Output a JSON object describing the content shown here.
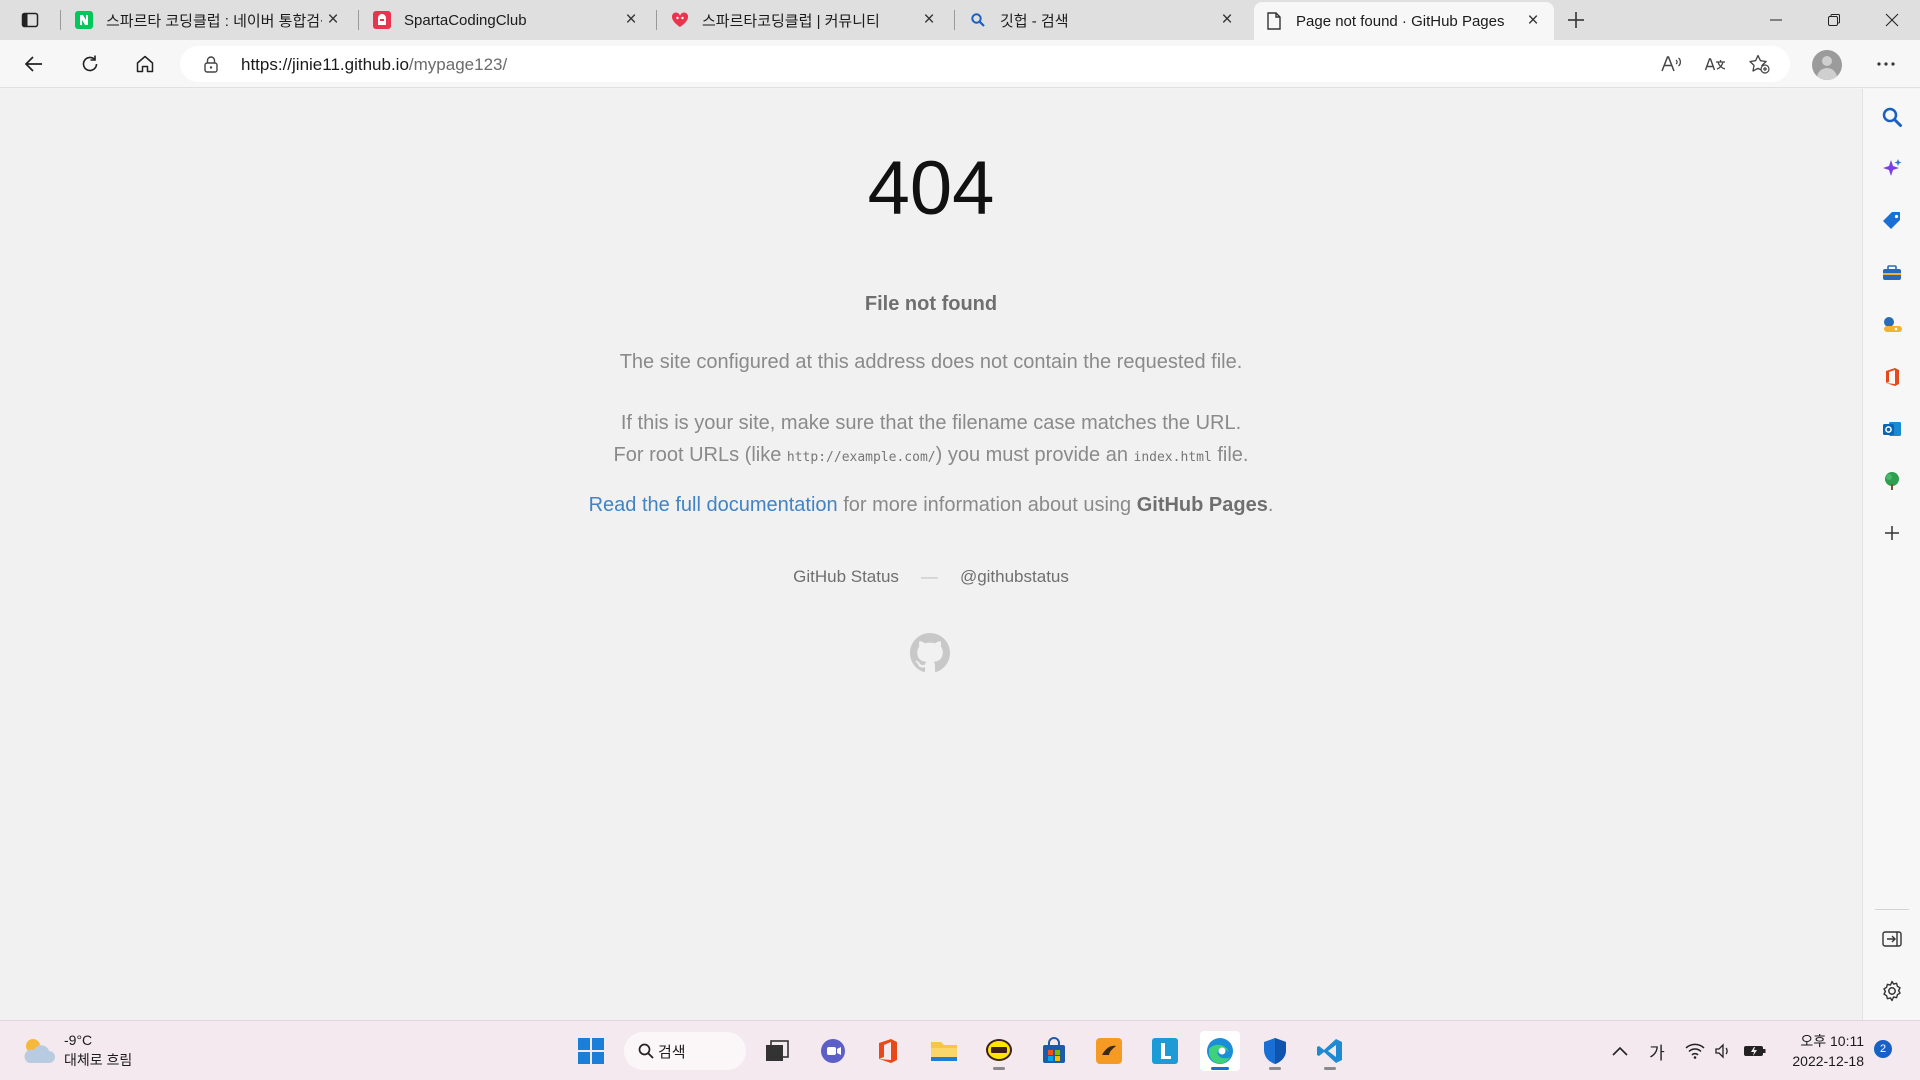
{
  "browser": {
    "tabs": [
      {
        "title": "스파르타 코딩클럽 : 네이버 통합검색",
        "favicon": "naver-icon"
      },
      {
        "title": "SpartaCodingClub",
        "favicon": "sparta-icon"
      },
      {
        "title": "스파르타코딩클럽 | 커뮤니티",
        "favicon": "sparta-heart-icon"
      },
      {
        "title": "깃헙 - 검색",
        "favicon": "search-icon"
      },
      {
        "title": "Page not found · GitHub Pages",
        "favicon": "page-icon",
        "active": true
      }
    ],
    "url_host": "https://jinie11.github.io",
    "url_path": "/mypage123/"
  },
  "page": {
    "code": "404",
    "heading": "File not found",
    "p1": "The site configured at this address does not contain the requested file.",
    "p2_line1": "If this is your site, make sure that the filename case matches the URL.",
    "p2_line2_a": "For root URLs (like ",
    "p2_code1": "http://example.com/",
    "p2_line2_b": ") you must provide an ",
    "p2_code2": "index.html",
    "p2_line2_c": " file.",
    "p3_link": "Read the full documentation",
    "p3_text": " for more information about using ",
    "p3_bold": "GitHub Pages",
    "p3_end": ".",
    "footer_status": "GitHub Status",
    "footer_dash": "—",
    "footer_twitter": "@githubstatus"
  },
  "taskbar": {
    "temp": "-9°C",
    "condition": "대체로 흐림",
    "search_label": "검색",
    "ime": "가",
    "time": "오후 10:11",
    "date": "2022-12-18",
    "notifications": "2"
  },
  "colors": {
    "link": "#4183c4",
    "accent": "#1a6fd4",
    "taskbar_bg": "#f4e9ee"
  }
}
